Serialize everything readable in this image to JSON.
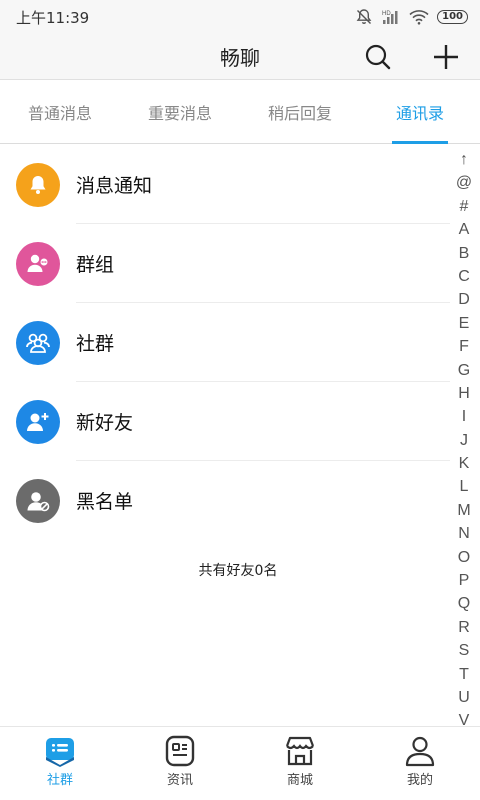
{
  "status": {
    "time": "上午11:39",
    "battery": "100"
  },
  "header": {
    "title": "畅聊"
  },
  "tabs": [
    {
      "label": "普通消息"
    },
    {
      "label": "重要消息"
    },
    {
      "label": "稍后回复"
    },
    {
      "label": "通讯录",
      "active": true
    }
  ],
  "contacts": [
    {
      "label": "消息通知",
      "icon": "bell-icon",
      "color": "#f5a21b"
    },
    {
      "label": "群组",
      "icon": "group-chat-icon",
      "color": "#e0569b"
    },
    {
      "label": "社群",
      "icon": "community-icon",
      "color": "#1e88e5"
    },
    {
      "label": "新好友",
      "icon": "add-friend-icon",
      "color": "#1e88e5"
    },
    {
      "label": "黑名单",
      "icon": "blocked-user-icon",
      "color": "#6b6b6b"
    }
  ],
  "friend_count_text": "共有好友0名",
  "index_letters": [
    "↑",
    "@",
    "#",
    "A",
    "B",
    "C",
    "D",
    "E",
    "F",
    "G",
    "H",
    "I",
    "J",
    "K",
    "L",
    "M",
    "N",
    "O",
    "P",
    "Q",
    "R",
    "S",
    "T",
    "U",
    "V"
  ],
  "bottom_nav": [
    {
      "label": "社群",
      "active": true
    },
    {
      "label": "资讯"
    },
    {
      "label": "商城"
    },
    {
      "label": "我的"
    }
  ],
  "colors": {
    "accent": "#1e9ee6"
  }
}
